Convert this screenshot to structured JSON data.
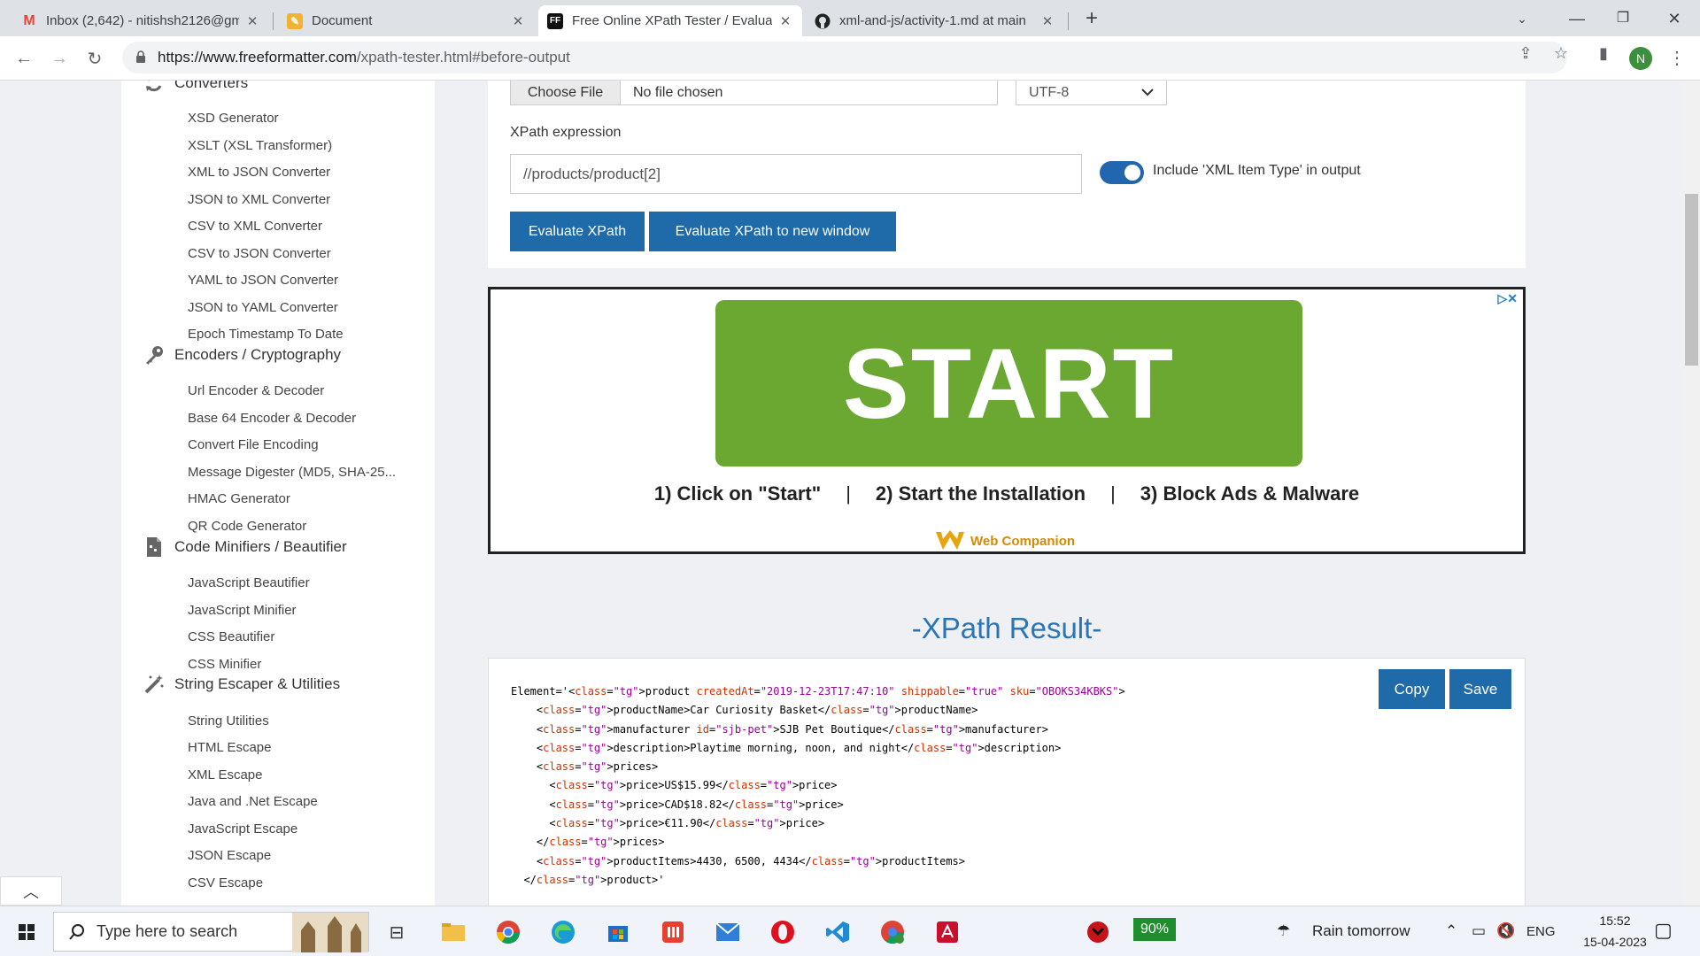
{
  "browser": {
    "tabs": [
      {
        "title": "Inbox (2,642) - nitishsh2126@gm",
        "icon": "gmail-icon",
        "active": false
      },
      {
        "title": "Document",
        "icon": "document-icon",
        "active": false
      },
      {
        "title": "Free Online XPath Tester / Evalua",
        "icon": "ff-icon",
        "active": true
      },
      {
        "title": "xml-and-js/activity-1.md at main",
        "icon": "github-icon",
        "active": false
      }
    ],
    "url_host": "https://www.freeformatter.com",
    "url_path": "/xpath-tester.html#before-output",
    "profile_initial": "N"
  },
  "sidebar": {
    "categories": [
      {
        "label": "Converters",
        "icon": "refresh-icon",
        "items": [
          "XSD Generator",
          "XSLT (XSL Transformer)",
          "XML to JSON Converter",
          "JSON to XML Converter",
          "CSV to XML Converter",
          "CSV to JSON Converter",
          "YAML to JSON Converter",
          "JSON to YAML Converter",
          "Epoch Timestamp To Date"
        ]
      },
      {
        "label": "Encoders / Cryptography",
        "icon": "key-icon",
        "items": [
          "Url Encoder & Decoder",
          "Base 64 Encoder & Decoder",
          "Convert File Encoding",
          "Message Digester (MD5, SHA-25...",
          "HMAC Generator",
          "QR Code Generator"
        ]
      },
      {
        "label": "Code Minifiers / Beautifier",
        "icon": "file-icon",
        "items": [
          "JavaScript Beautifier",
          "JavaScript Minifier",
          "CSS Beautifier",
          "CSS Minifier"
        ]
      },
      {
        "label": "String Escaper & Utilities",
        "icon": "magic-wand-icon",
        "items": [
          "String Utilities",
          "HTML Escape",
          "XML Escape",
          "Java and .Net Escape",
          "JavaScript Escape",
          "JSON Escape",
          "CSV Escape"
        ]
      }
    ]
  },
  "form": {
    "choose_file_label": "Choose File",
    "file_status": "No file chosen",
    "encoding": "UTF-8",
    "xpath_label": "XPath expression",
    "xpath_value": "//products/product[2]",
    "toggle_label": "Include 'XML Item Type' in output",
    "toggle_on": true,
    "evaluate_label": "Evaluate XPath",
    "evaluate_new_label": "Evaluate XPath to new window"
  },
  "ad": {
    "button_text": "START",
    "step1": "1) Click on \"Start\"",
    "step2": "2) Start the Installation",
    "step3": "3) Block Ads & Malware",
    "separator": "|",
    "brand": "Web Companion",
    "adchoice": "▷✕"
  },
  "result": {
    "title": "-XPath Result-",
    "copy_label": "Copy",
    "save_label": "Save",
    "lines": [
      "Element='<product createdAt=\"2019-12-23T17:47:10\" shippable=\"true\" sku=\"OBOKS34KBKS\">",
      "    <productName>Car Curiosity Basket</productName>",
      "    <manufacturer id=\"sjb-pet\">SJB Pet Boutique</manufacturer>",
      "    <description>Playtime morning, noon, and night</description>",
      "    <prices>",
      "      <price>US$15.99</price>",
      "      <price>CAD$18.82</price>",
      "      <price>€11.90</price>",
      "    </prices>",
      "    <productItems>4430, 6500, 4434</productItems>",
      "  </product>'"
    ]
  },
  "taskbar": {
    "search_placeholder": "Type here to search",
    "battery": "90%",
    "weather": "Rain tomorrow",
    "language": "ENG",
    "time": "15:52",
    "date": "15-04-2023"
  },
  "colors": {
    "accent": "#1f6aa8",
    "result_title": "#2a74b8",
    "ad_green": "#6aa832"
  }
}
